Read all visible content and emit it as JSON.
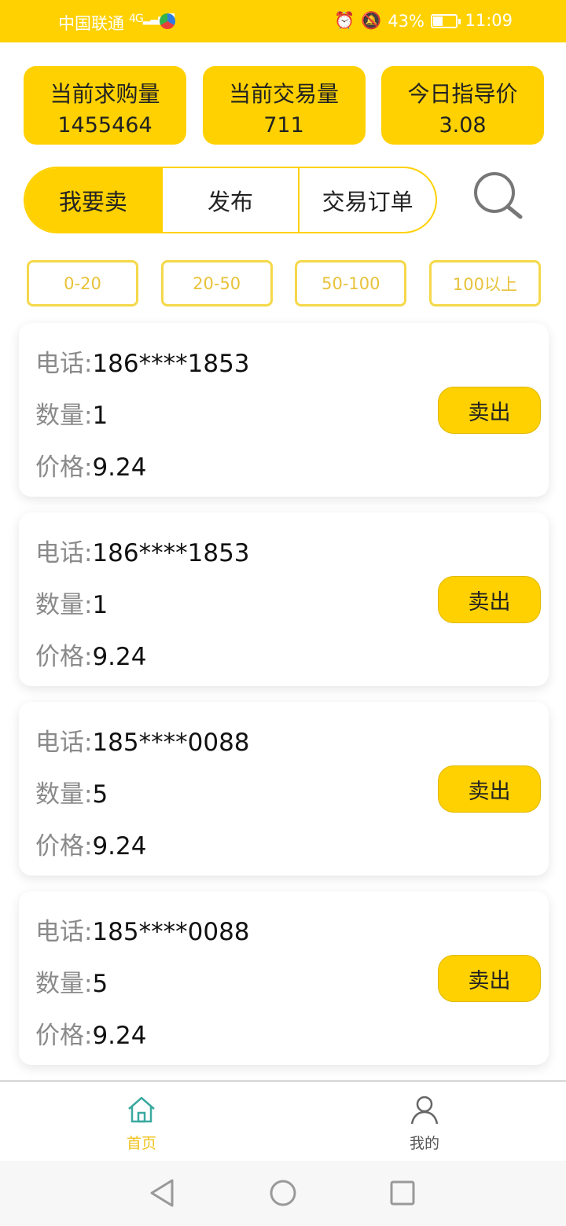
{
  "status_bar": {
    "carrier": "中国联通",
    "network": "4G",
    "battery_percent": "43%",
    "battery_level": 0.43,
    "time": "11:09"
  },
  "stats": [
    {
      "label": "当前求购量",
      "value": "1455464"
    },
    {
      "label": "当前交易量",
      "value": "711"
    },
    {
      "label": "今日指导价",
      "value": "3.08"
    }
  ],
  "segments": [
    {
      "label": "我要卖",
      "active": true
    },
    {
      "label": "发布",
      "active": false
    },
    {
      "label": "交易订单",
      "active": false
    }
  ],
  "filters": [
    "0-20",
    "20-50",
    "50-100",
    "100以上"
  ],
  "field_labels": {
    "phone": "电话:",
    "qty": "数量:",
    "price": "价格:"
  },
  "orders": [
    {
      "phone": "186****1853",
      "qty": "1",
      "price": "9.24",
      "action": "卖出"
    },
    {
      "phone": "186****1853",
      "qty": "1",
      "price": "9.24",
      "action": "卖出"
    },
    {
      "phone": "185****0088",
      "qty": "5",
      "price": "9.24",
      "action": "卖出"
    },
    {
      "phone": "185****0088",
      "qty": "5",
      "price": "9.24",
      "action": "卖出"
    }
  ],
  "tabs": [
    {
      "label": "首页",
      "icon": "home-icon",
      "active": true
    },
    {
      "label": "我的",
      "icon": "user-icon",
      "active": false
    }
  ],
  "colors": {
    "accent": "#ffd100",
    "tab_active": "#f0c21e",
    "chip_text": "#e8c23a",
    "label_grey": "#8a8a8a"
  }
}
